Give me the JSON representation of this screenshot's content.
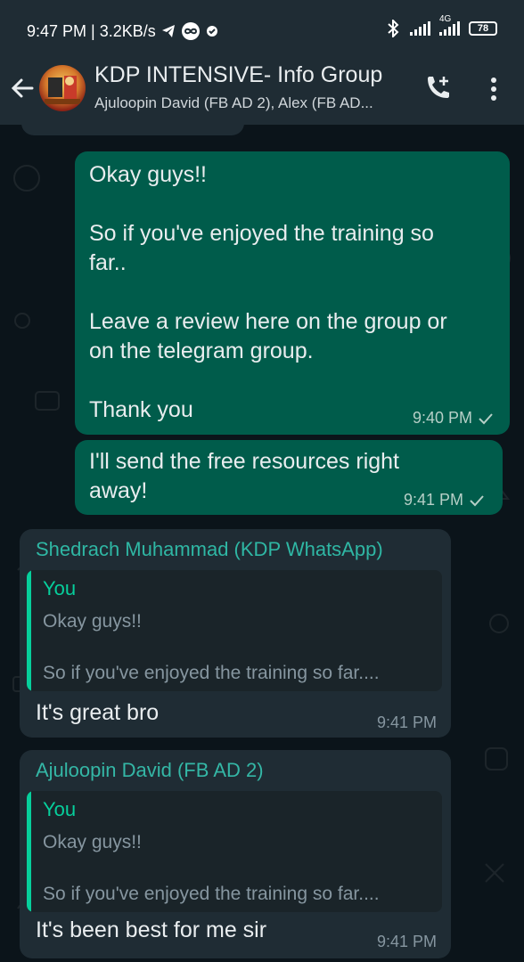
{
  "status_bar": {
    "time_and_speed": "9:47 PM | 3.2KB/s",
    "network_label": "4G",
    "battery": "78"
  },
  "header": {
    "title": "KDP INTENSIVE- Info Group",
    "participants": "Ajuloopin David (FB AD 2), Alex (FB AD..."
  },
  "messages": [
    {
      "direction": "outgoing",
      "text": "Okay guys!!\n\nSo if you've enjoyed the training so\nfar..\n\nLeave a review here on the group or\non the telegram group.\n\nThank you",
      "time": "9:40 PM",
      "status": "sent"
    },
    {
      "direction": "outgoing",
      "text": "I'll send the free resources right\naway!",
      "time": "9:41 PM",
      "status": "sent"
    },
    {
      "direction": "incoming",
      "sender": "Shedrach Muhammad (KDP WhatsApp)",
      "sender_color": "#53bdeb",
      "quote": {
        "author": "You",
        "line1": "Okay guys!!",
        "line2": "So if you've enjoyed the training so far...."
      },
      "text": "It's great bro",
      "time": "9:41 PM"
    },
    {
      "direction": "incoming",
      "sender": "Ajuloopin David (FB AD 2)",
      "sender_color": "#5fb5f1",
      "quote": {
        "author": "You",
        "line1": "Okay guys!!",
        "line2": "So if you've enjoyed the training so far...."
      },
      "text": "It's been best for me sir",
      "time": "9:41 PM"
    }
  ],
  "colors": {
    "header_bg": "#1f2c34",
    "chat_bg": "#0b141a",
    "outgoing_bubble": "#005c4b",
    "incoming_bubble": "#1f2c34",
    "quote_accent": "#06cf9c"
  }
}
